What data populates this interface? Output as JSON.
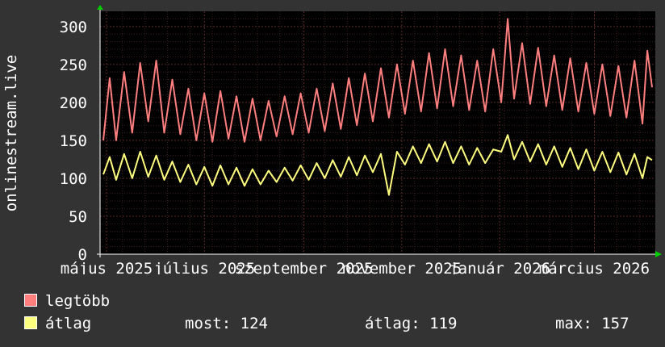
{
  "chart_data": {
    "type": "line",
    "ylabel": "onlinestream.live",
    "ylim": [
      0,
      320
    ],
    "y_ticks": [
      0,
      50,
      100,
      150,
      200,
      250,
      300
    ],
    "x_range": [
      "2025-04-27",
      "2026-04-08"
    ],
    "x_ticks": [
      {
        "label": "május 2025",
        "date": "2025-05-01"
      },
      {
        "label": "július 2025",
        "date": "2025-07-01"
      },
      {
        "label": "szeptember 2025",
        "date": "2025-09-01"
      },
      {
        "label": "november 2025",
        "date": "2025-11-01"
      },
      {
        "label": "január 2026",
        "date": "2026-01-01"
      },
      {
        "label": "március 2026",
        "date": "2026-03-01"
      }
    ],
    "grid": true,
    "background": "#000000",
    "grid_color": "#5a2a2a",
    "series": [
      {
        "name": "legtöbb",
        "color": "#ff7f7f",
        "points": [
          [
            "2025-04-29",
            150
          ],
          [
            "2025-05-03",
            232
          ],
          [
            "2025-05-07",
            150
          ],
          [
            "2025-05-12",
            240
          ],
          [
            "2025-05-17",
            160
          ],
          [
            "2025-05-22",
            252
          ],
          [
            "2025-05-27",
            175
          ],
          [
            "2025-06-01",
            255
          ],
          [
            "2025-06-06",
            160
          ],
          [
            "2025-06-11",
            230
          ],
          [
            "2025-06-16",
            158
          ],
          [
            "2025-06-21",
            218
          ],
          [
            "2025-06-26",
            150
          ],
          [
            "2025-07-01",
            212
          ],
          [
            "2025-07-06",
            148
          ],
          [
            "2025-07-11",
            215
          ],
          [
            "2025-07-16",
            152
          ],
          [
            "2025-07-21",
            208
          ],
          [
            "2025-07-26",
            148
          ],
          [
            "2025-07-31",
            205
          ],
          [
            "2025-08-05",
            150
          ],
          [
            "2025-08-10",
            202
          ],
          [
            "2025-08-15",
            155
          ],
          [
            "2025-08-20",
            208
          ],
          [
            "2025-08-25",
            158
          ],
          [
            "2025-08-30",
            212
          ],
          [
            "2025-09-04",
            160
          ],
          [
            "2025-09-09",
            218
          ],
          [
            "2025-09-14",
            162
          ],
          [
            "2025-09-19",
            225
          ],
          [
            "2025-09-24",
            165
          ],
          [
            "2025-09-29",
            232
          ],
          [
            "2025-10-04",
            170
          ],
          [
            "2025-10-09",
            238
          ],
          [
            "2025-10-14",
            175
          ],
          [
            "2025-10-19",
            245
          ],
          [
            "2025-10-24",
            180
          ],
          [
            "2025-10-29",
            250
          ],
          [
            "2025-11-03",
            185
          ],
          [
            "2025-11-08",
            255
          ],
          [
            "2025-11-13",
            188
          ],
          [
            "2025-11-18",
            265
          ],
          [
            "2025-11-23",
            192
          ],
          [
            "2025-11-28",
            270
          ],
          [
            "2025-12-03",
            195
          ],
          [
            "2025-12-08",
            262
          ],
          [
            "2025-12-13",
            190
          ],
          [
            "2025-12-18",
            255
          ],
          [
            "2025-12-23",
            188
          ],
          [
            "2025-12-28",
            270
          ],
          [
            "2026-01-02",
            200
          ],
          [
            "2026-01-06",
            310
          ],
          [
            "2026-01-10",
            205
          ],
          [
            "2026-01-15",
            278
          ],
          [
            "2026-01-20",
            198
          ],
          [
            "2026-01-25",
            272
          ],
          [
            "2026-01-30",
            195
          ],
          [
            "2026-02-04",
            262
          ],
          [
            "2026-02-09",
            190
          ],
          [
            "2026-02-14",
            258
          ],
          [
            "2026-02-19",
            188
          ],
          [
            "2026-02-24",
            252
          ],
          [
            "2026-03-01",
            185
          ],
          [
            "2026-03-06",
            250
          ],
          [
            "2026-03-11",
            182
          ],
          [
            "2026-03-16",
            248
          ],
          [
            "2026-03-21",
            180
          ],
          [
            "2026-03-26",
            255
          ],
          [
            "2026-03-31",
            172
          ],
          [
            "2026-04-03",
            268
          ],
          [
            "2026-04-06",
            220
          ]
        ]
      },
      {
        "name": "átlag",
        "color": "#ffff7f",
        "points": [
          [
            "2025-04-29",
            105
          ],
          [
            "2025-05-03",
            128
          ],
          [
            "2025-05-07",
            98
          ],
          [
            "2025-05-12",
            132
          ],
          [
            "2025-05-17",
            100
          ],
          [
            "2025-05-22",
            135
          ],
          [
            "2025-05-27",
            102
          ],
          [
            "2025-06-01",
            130
          ],
          [
            "2025-06-06",
            98
          ],
          [
            "2025-06-11",
            122
          ],
          [
            "2025-06-16",
            95
          ],
          [
            "2025-06-21",
            118
          ],
          [
            "2025-06-26",
            92
          ],
          [
            "2025-07-01",
            115
          ],
          [
            "2025-07-06",
            90
          ],
          [
            "2025-07-11",
            117
          ],
          [
            "2025-07-16",
            92
          ],
          [
            "2025-07-21",
            114
          ],
          [
            "2025-07-26",
            90
          ],
          [
            "2025-07-31",
            112
          ],
          [
            "2025-08-05",
            92
          ],
          [
            "2025-08-10",
            110
          ],
          [
            "2025-08-15",
            95
          ],
          [
            "2025-08-20",
            114
          ],
          [
            "2025-08-25",
            97
          ],
          [
            "2025-08-30",
            117
          ],
          [
            "2025-09-04",
            98
          ],
          [
            "2025-09-09",
            120
          ],
          [
            "2025-09-14",
            100
          ],
          [
            "2025-09-19",
            124
          ],
          [
            "2025-09-24",
            102
          ],
          [
            "2025-09-29",
            128
          ],
          [
            "2025-10-04",
            104
          ],
          [
            "2025-10-09",
            130
          ],
          [
            "2025-10-14",
            108
          ],
          [
            "2025-10-19",
            132
          ],
          [
            "2025-10-24",
            78
          ],
          [
            "2025-10-29",
            135
          ],
          [
            "2025-11-03",
            118
          ],
          [
            "2025-11-08",
            142
          ],
          [
            "2025-11-13",
            120
          ],
          [
            "2025-11-18",
            145
          ],
          [
            "2025-11-23",
            122
          ],
          [
            "2025-11-28",
            148
          ],
          [
            "2025-12-03",
            120
          ],
          [
            "2025-12-08",
            142
          ],
          [
            "2025-12-13",
            118
          ],
          [
            "2025-12-18",
            140
          ],
          [
            "2025-12-23",
            120
          ],
          [
            "2025-12-28",
            138
          ],
          [
            "2026-01-02",
            135
          ],
          [
            "2026-01-06",
            157
          ],
          [
            "2026-01-10",
            125
          ],
          [
            "2026-01-15",
            148
          ],
          [
            "2026-01-20",
            122
          ],
          [
            "2026-01-25",
            145
          ],
          [
            "2026-01-30",
            118
          ],
          [
            "2026-02-04",
            142
          ],
          [
            "2026-02-09",
            115
          ],
          [
            "2026-02-14",
            140
          ],
          [
            "2026-02-19",
            112
          ],
          [
            "2026-02-24",
            138
          ],
          [
            "2026-03-01",
            110
          ],
          [
            "2026-03-06",
            135
          ],
          [
            "2026-03-11",
            108
          ],
          [
            "2026-03-16",
            134
          ],
          [
            "2026-03-21",
            105
          ],
          [
            "2026-03-26",
            132
          ],
          [
            "2026-03-31",
            100
          ],
          [
            "2026-04-03",
            128
          ],
          [
            "2026-04-06",
            124
          ]
        ]
      }
    ]
  },
  "legend": {
    "items": [
      {
        "label": "legtöbb",
        "color": "#ff7f7f"
      },
      {
        "label": "átlag",
        "color": "#ffff7f"
      }
    ],
    "stats": {
      "now": "most: 124",
      "avg": "átlag: 119",
      "max": "max: 157"
    }
  }
}
